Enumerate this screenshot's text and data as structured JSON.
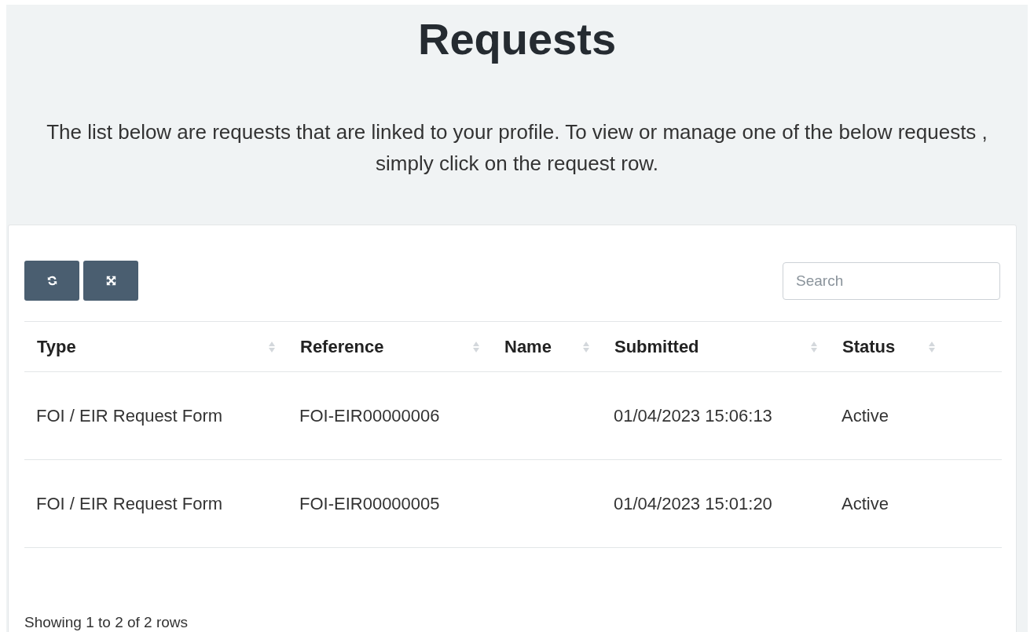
{
  "title": "Requests",
  "intro": "The list below are requests that are linked to your profile. To view or manage one of the below requests , simply click on the request row.",
  "toolbar": {
    "buttons": [
      {
        "kind": "refresh"
      },
      {
        "kind": "fullscreen"
      }
    ],
    "search": {
      "placeholder": "Search"
    }
  },
  "table": {
    "columns": [
      "Type",
      "Reference",
      "Name",
      "Submitted",
      "Status"
    ],
    "rows": [
      {
        "type": "FOI / EIR Request Form",
        "reference": "FOI-EIR00000006",
        "submitted": "01/04/2023 15:06:13",
        "status": "Active"
      },
      {
        "type": "FOI / EIR Request Form",
        "reference": "FOI-EIR00000005",
        "submitted": "01/04/2023 15:01:20",
        "status": "Active"
      }
    ]
  },
  "pagination_info": "Showing 1 to 2 of 2 rows"
}
